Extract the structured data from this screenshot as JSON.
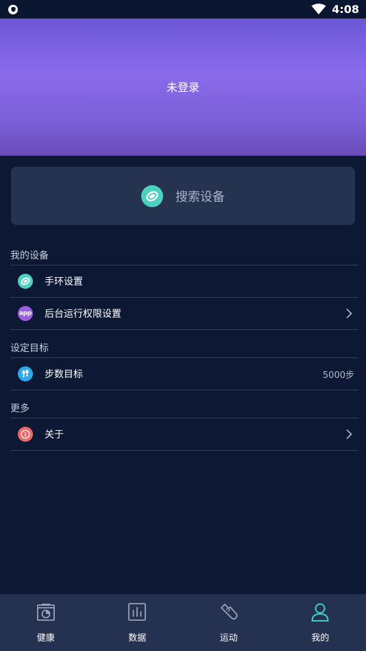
{
  "status_bar": {
    "time": "4:08"
  },
  "header": {
    "title": "未登录"
  },
  "search_card": {
    "label": "搜索设备"
  },
  "sections": {
    "my_devices": {
      "title": "我的设备",
      "items": [
        {
          "label": "手环设置",
          "icon": "band-icon"
        },
        {
          "label": "后台运行权限设置",
          "icon": "app-icon",
          "icon_text": "app"
        }
      ]
    },
    "goals": {
      "title": "设定目标",
      "items": [
        {
          "label": "步数目标",
          "value": "5000步",
          "icon": "footsteps-icon"
        }
      ]
    },
    "more": {
      "title": "更多",
      "items": [
        {
          "label": "关于",
          "icon": "info-icon"
        }
      ]
    }
  },
  "bottom_nav": {
    "items": [
      {
        "label": "健康",
        "icon": "health-icon"
      },
      {
        "label": "数据",
        "icon": "data-icon"
      },
      {
        "label": "运动",
        "icon": "sport-shoe-icon"
      },
      {
        "label": "我的",
        "icon": "user-icon",
        "active": true
      }
    ]
  },
  "colors": {
    "background": "#0c1834",
    "card": "#253350",
    "accent_teal": "#4fd1c0",
    "accent_purple": "#9a5fe0",
    "accent_blue": "#2ea8e8",
    "accent_red": "#e96a6a",
    "nav_active": "#3fd1c5"
  }
}
